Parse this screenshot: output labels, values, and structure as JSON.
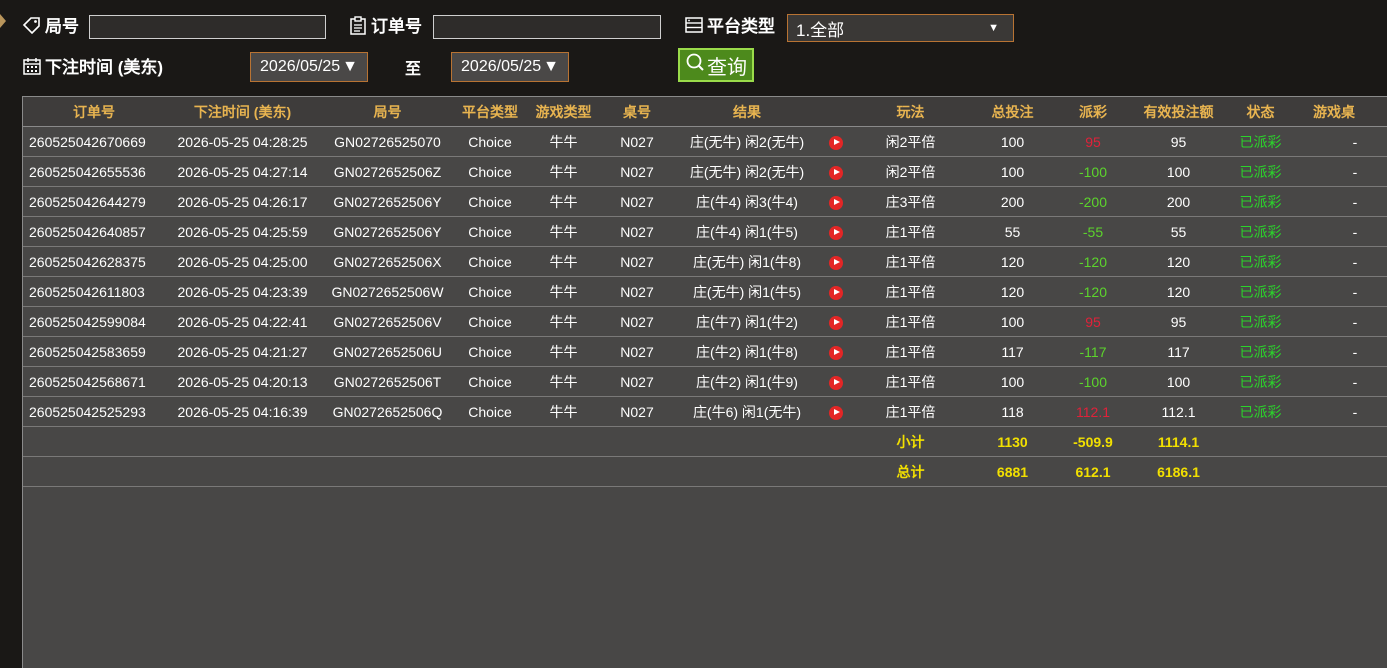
{
  "filters": {
    "ju_label": "局号",
    "ju_value": "",
    "order_label": "订单号",
    "order_value": "",
    "platform_label": "平台类型",
    "platform_selected": "1.全部",
    "time_label": "下注时间 (美东)",
    "date_from": "2026/05/25",
    "to_label": "至",
    "date_to": "2026/05/25",
    "query_label": "查询"
  },
  "table": {
    "headers": [
      "订单号",
      "下注时间 (美东)",
      "局号",
      "平台类型",
      "游戏类型",
      "桌号",
      "结果",
      "",
      "玩法",
      "总投注",
      "派彩",
      "有效投注额",
      "状态",
      "游戏桌"
    ],
    "rows": [
      {
        "order": "260525042670669",
        "time": "2026-05-25 04:28:25",
        "round": "GN02726525070",
        "platform": "Choice",
        "game": "牛牛",
        "table": "N027",
        "result": "庄(无牛) 闲2(无牛)",
        "play": "闲2平倍",
        "bet": "100",
        "payout": "95",
        "payout_color": "#e0213a",
        "valid": "95",
        "status": "已派彩",
        "extra": "-"
      },
      {
        "order": "260525042655536",
        "time": "2026-05-25 04:27:14",
        "round": "GN0272652506Z",
        "platform": "Choice",
        "game": "牛牛",
        "table": "N027",
        "result": "庄(无牛) 闲2(无牛)",
        "play": "闲2平倍",
        "bet": "100",
        "payout": "-100",
        "payout_color": "#5cd42c",
        "valid": "100",
        "status": "已派彩",
        "extra": "-"
      },
      {
        "order": "260525042644279",
        "time": "2026-05-25 04:26:17",
        "round": "GN0272652506Y",
        "platform": "Choice",
        "game": "牛牛",
        "table": "N027",
        "result": "庄(牛4) 闲3(牛4)",
        "play": "庄3平倍",
        "bet": "200",
        "payout": "-200",
        "payout_color": "#5cd42c",
        "valid": "200",
        "status": "已派彩",
        "extra": "-"
      },
      {
        "order": "260525042640857",
        "time": "2026-05-25 04:25:59",
        "round": "GN0272652506Y",
        "platform": "Choice",
        "game": "牛牛",
        "table": "N027",
        "result": "庄(牛4) 闲1(牛5)",
        "play": "庄1平倍",
        "bet": "55",
        "payout": "-55",
        "payout_color": "#5cd42c",
        "valid": "55",
        "status": "已派彩",
        "extra": "-"
      },
      {
        "order": "260525042628375",
        "time": "2026-05-25 04:25:00",
        "round": "GN0272652506X",
        "platform": "Choice",
        "game": "牛牛",
        "table": "N027",
        "result": "庄(无牛) 闲1(牛8)",
        "play": "庄1平倍",
        "bet": "120",
        "payout": "-120",
        "payout_color": "#5cd42c",
        "valid": "120",
        "status": "已派彩",
        "extra": "-"
      },
      {
        "order": "260525042611803",
        "time": "2026-05-25 04:23:39",
        "round": "GN0272652506W",
        "platform": "Choice",
        "game": "牛牛",
        "table": "N027",
        "result": "庄(无牛) 闲1(牛5)",
        "play": "庄1平倍",
        "bet": "120",
        "payout": "-120",
        "payout_color": "#5cd42c",
        "valid": "120",
        "status": "已派彩",
        "extra": "-"
      },
      {
        "order": "260525042599084",
        "time": "2026-05-25 04:22:41",
        "round": "GN0272652506V",
        "platform": "Choice",
        "game": "牛牛",
        "table": "N027",
        "result": "庄(牛7) 闲1(牛2)",
        "play": "庄1平倍",
        "bet": "100",
        "payout": "95",
        "payout_color": "#e0213a",
        "valid": "95",
        "status": "已派彩",
        "extra": "-"
      },
      {
        "order": "260525042583659",
        "time": "2026-05-25 04:21:27",
        "round": "GN0272652506U",
        "platform": "Choice",
        "game": "牛牛",
        "table": "N027",
        "result": "庄(牛2) 闲1(牛8)",
        "play": "庄1平倍",
        "bet": "117",
        "payout": "-117",
        "payout_color": "#5cd42c",
        "valid": "117",
        "status": "已派彩",
        "extra": "-"
      },
      {
        "order": "260525042568671",
        "time": "2026-05-25 04:20:13",
        "round": "GN0272652506T",
        "platform": "Choice",
        "game": "牛牛",
        "table": "N027",
        "result": "庄(牛2) 闲1(牛9)",
        "play": "庄1平倍",
        "bet": "100",
        "payout": "-100",
        "payout_color": "#5cd42c",
        "valid": "100",
        "status": "已派彩",
        "extra": "-"
      },
      {
        "order": "260525042525293",
        "time": "2026-05-25 04:16:39",
        "round": "GN0272652506Q",
        "platform": "Choice",
        "game": "牛牛",
        "table": "N027",
        "result": "庄(牛6) 闲1(无牛)",
        "play": "庄1平倍",
        "bet": "118",
        "payout": "112.1",
        "payout_color": "#e0213a",
        "valid": "112.1",
        "status": "已派彩",
        "extra": "-"
      }
    ],
    "status_color": "#2bd42b",
    "subtotal": {
      "label": "小计",
      "bet": "1130",
      "payout": "-509.9",
      "valid": "1114.1"
    },
    "total": {
      "label": "总计",
      "bet": "6881",
      "payout": "612.1",
      "valid": "6186.1"
    }
  }
}
